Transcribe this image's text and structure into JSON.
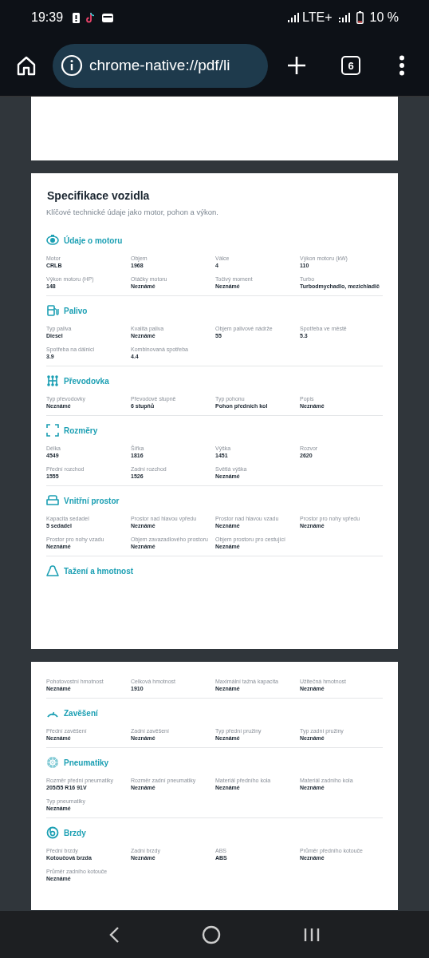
{
  "status_bar": {
    "time": "19:39",
    "network": "LTE+",
    "battery": "10 %"
  },
  "browser": {
    "url": "chrome-native://pdf/li",
    "tab_count": "6"
  },
  "pages": [
    {
      "kind": "tail"
    },
    {
      "kind": "start",
      "title": "Specifikace vozidla",
      "subtitle": "Klíčové technické údaje jako motor, pohon a výkon.",
      "sections": [
        {
          "kind": "engine",
          "title": "Údaje o motoru",
          "fields": [
            {
              "label": "Motor",
              "value": "CRLB"
            },
            {
              "label": "Objem",
              "value": "1968"
            },
            {
              "label": "Válce",
              "value": "4"
            },
            {
              "label": "Výkon motoru (kW)",
              "value": "110"
            },
            {
              "label": "Výkon motoru (HP)",
              "value": "148"
            },
            {
              "label": "Otáčky motoru",
              "value": "Neznámé"
            },
            {
              "label": "Točivý moment",
              "value": "Neznámé"
            },
            {
              "label": "Turbo",
              "value": "Turbodmychadlo, mezichladič"
            }
          ]
        },
        {
          "kind": "fuel",
          "title": "Palivo",
          "fields": [
            {
              "label": "Typ paliva",
              "value": "Diesel"
            },
            {
              "label": "Kvalita paliva",
              "value": "Neznámé"
            },
            {
              "label": "Objem palivové nádrže",
              "value": "55"
            },
            {
              "label": "Spotřeba ve městě",
              "value": "5.3"
            },
            {
              "label": "Spotřeba na dálnici",
              "value": "3.9"
            },
            {
              "label": "Kombinovaná spotřeba",
              "value": "4.4"
            }
          ]
        },
        {
          "kind": "gearbox",
          "title": "Převodovka",
          "fields": [
            {
              "label": "Typ převodovky",
              "value": "Neznámé"
            },
            {
              "label": "Převodové stupně",
              "value": "6 stupňů"
            },
            {
              "label": "Typ pohonu",
              "value": "Pohon předních kol"
            },
            {
              "label": "Popis",
              "value": "Neznámé"
            }
          ]
        },
        {
          "kind": "dimensions",
          "title": "Rozměry",
          "fields": [
            {
              "label": "Délka",
              "value": "4549"
            },
            {
              "label": "Šířka",
              "value": "1816"
            },
            {
              "label": "Výška",
              "value": "1451"
            },
            {
              "label": "Rozvor",
              "value": "2620"
            },
            {
              "label": "Přední rozchod",
              "value": "1555"
            },
            {
              "label": "Zadní rozchod",
              "value": "1526"
            },
            {
              "label": "Světlá výška",
              "value": "Neznámé"
            }
          ]
        },
        {
          "kind": "interior",
          "title": "Vnitřní prostor",
          "fields": [
            {
              "label": "Kapacita sedadel",
              "value": "5 sedadel"
            },
            {
              "label": "Prostor nad hlavou vpředu",
              "value": "Neznámé"
            },
            {
              "label": "Prostor nad hlavou vzadu",
              "value": "Neznámé"
            },
            {
              "label": "Prostor pro nohy vpředu",
              "value": "Neznámé"
            },
            {
              "label": "Prostor pro nohy vzadu",
              "value": "Neznámé"
            },
            {
              "label": "Objem zavazadlového prostoru",
              "value": "Neznámé"
            },
            {
              "label": "Objem prostoru pro cestující",
              "value": "Neznámé"
            }
          ]
        },
        {
          "kind": "weight",
          "title": "Tažení a hmotnost"
        }
      ]
    },
    {
      "kind": "continued",
      "sections": [
        {
          "fields": [
            {
              "label": "Pohotovostní hmotnost",
              "value": "Neznámé"
            },
            {
              "label": "Celková hmotnost",
              "value": "1910"
            },
            {
              "label": "Maximální tažná kapacita",
              "value": "Neznámé"
            },
            {
              "label": "Užitečná hmotnost",
              "value": "Neznámé"
            }
          ]
        },
        {
          "kind": "suspension",
          "title": "Zavěšení",
          "fields": [
            {
              "label": "Přední zavěšení",
              "value": "Neznámé"
            },
            {
              "label": "Zadní zavěšení",
              "value": "Neznámé"
            },
            {
              "label": "Typ přední pružiny",
              "value": "Neznámé"
            },
            {
              "label": "Typ zadní pružiny",
              "value": "Neznámé"
            }
          ]
        },
        {
          "kind": "tyres",
          "title": "Pneumatiky",
          "fields": [
            {
              "label": "Rozměr přední pneumatiky",
              "value": "205/55 R16 91V"
            },
            {
              "label": "Rozměr zadní pneumatiky",
              "value": "Neznámé"
            },
            {
              "label": "Materiál předního kola",
              "value": "Neznámé"
            },
            {
              "label": "Materiál zadního kola",
              "value": "Neznámé"
            },
            {
              "label": "Typ pneumatiky",
              "value": "Neznámé"
            }
          ]
        },
        {
          "kind": "brakes",
          "title": "Brzdy",
          "fields": [
            {
              "label": "Přední brzdy",
              "value": "Kotoučová brzda"
            },
            {
              "label": "Zadní brzdy",
              "value": "Neznámé"
            },
            {
              "label": "ABS",
              "value": "ABS"
            },
            {
              "label": "Průměr předního kotouče",
              "value": "Neznámé"
            },
            {
              "label": "Průměr zadního kotouče",
              "value": "Neznámé"
            }
          ]
        }
      ]
    }
  ]
}
